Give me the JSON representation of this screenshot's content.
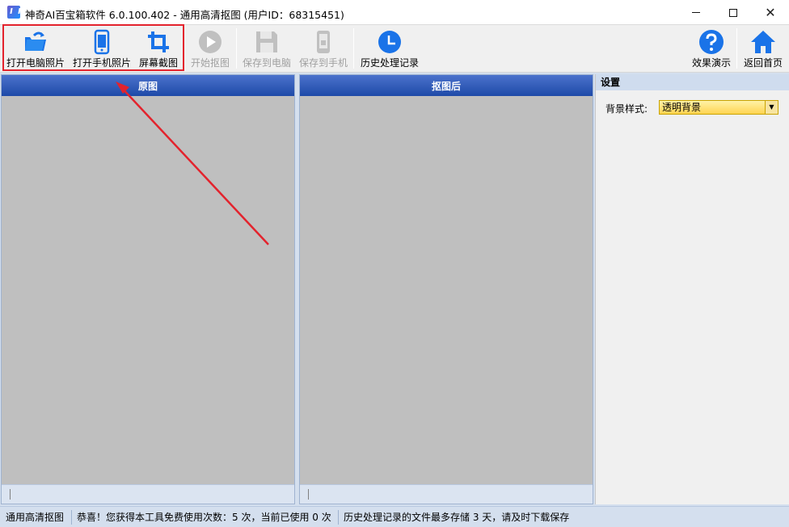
{
  "window": {
    "title": "神奇AI百宝箱软件 6.0.100.402 - 通用高清抠图 (用户ID：68315451)"
  },
  "toolbar": {
    "open_pc_photo": "打开电脑照片",
    "open_phone_photo": "打开手机照片",
    "screen_capture": "屏幕截图",
    "start_cutout": "开始抠图",
    "save_to_pc": "保存到电脑",
    "save_to_phone": "保存到手机",
    "history": "历史处理记录",
    "demo": "效果演示",
    "home": "返回首页"
  },
  "panels": {
    "original": "原图",
    "result": "抠图后"
  },
  "settings": {
    "title": "设置",
    "bg_style_label": "背景样式:",
    "bg_style_value": "透明背景"
  },
  "status": {
    "mode": "通用高清抠图",
    "usage": "恭喜！您获得本工具免费使用次数：5 次，当前已使用 0 次",
    "retention": "历史处理记录的文件最多存储 3 天，请及时下载保存"
  },
  "colors": {
    "accent": "#1a73e8",
    "panel_header": "#2752b5",
    "highlight": "#e3232d"
  }
}
